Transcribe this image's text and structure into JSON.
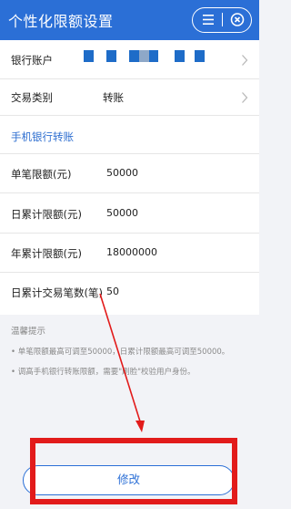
{
  "header": {
    "title": "个性化限额设置",
    "menu_icon": "menu-icon",
    "close_icon": "close-circle-icon",
    "color": "#2b6fd6"
  },
  "rows": [
    {
      "label": "银行账户",
      "value": "",
      "has_chevron": true
    },
    {
      "label": "交易类别",
      "value": "转账",
      "has_chevron": true
    },
    {
      "label": "手机银行转账",
      "value": ""
    },
    {
      "label": "单笔限额(元)",
      "value": "50000"
    },
    {
      "label": "日累计限额(元)",
      "value": "50000"
    },
    {
      "label": "年累计限额(元)",
      "value": "18000000"
    },
    {
      "label": "日累计交易笔数(笔)",
      "value": "50"
    }
  ],
  "tips": {
    "title": "温馨提示",
    "items": [
      "• 单笔限额最高可调至50000，日累计限额最高可调至50000。",
      "• 调高手机银行转账限额，需要\"刷脸\"校验用户身份。"
    ]
  },
  "button": {
    "label": "修改"
  },
  "colors": {
    "accent": "#2b6fd6",
    "highlight": "#e21b1b",
    "mask": "#1e6cc8"
  }
}
